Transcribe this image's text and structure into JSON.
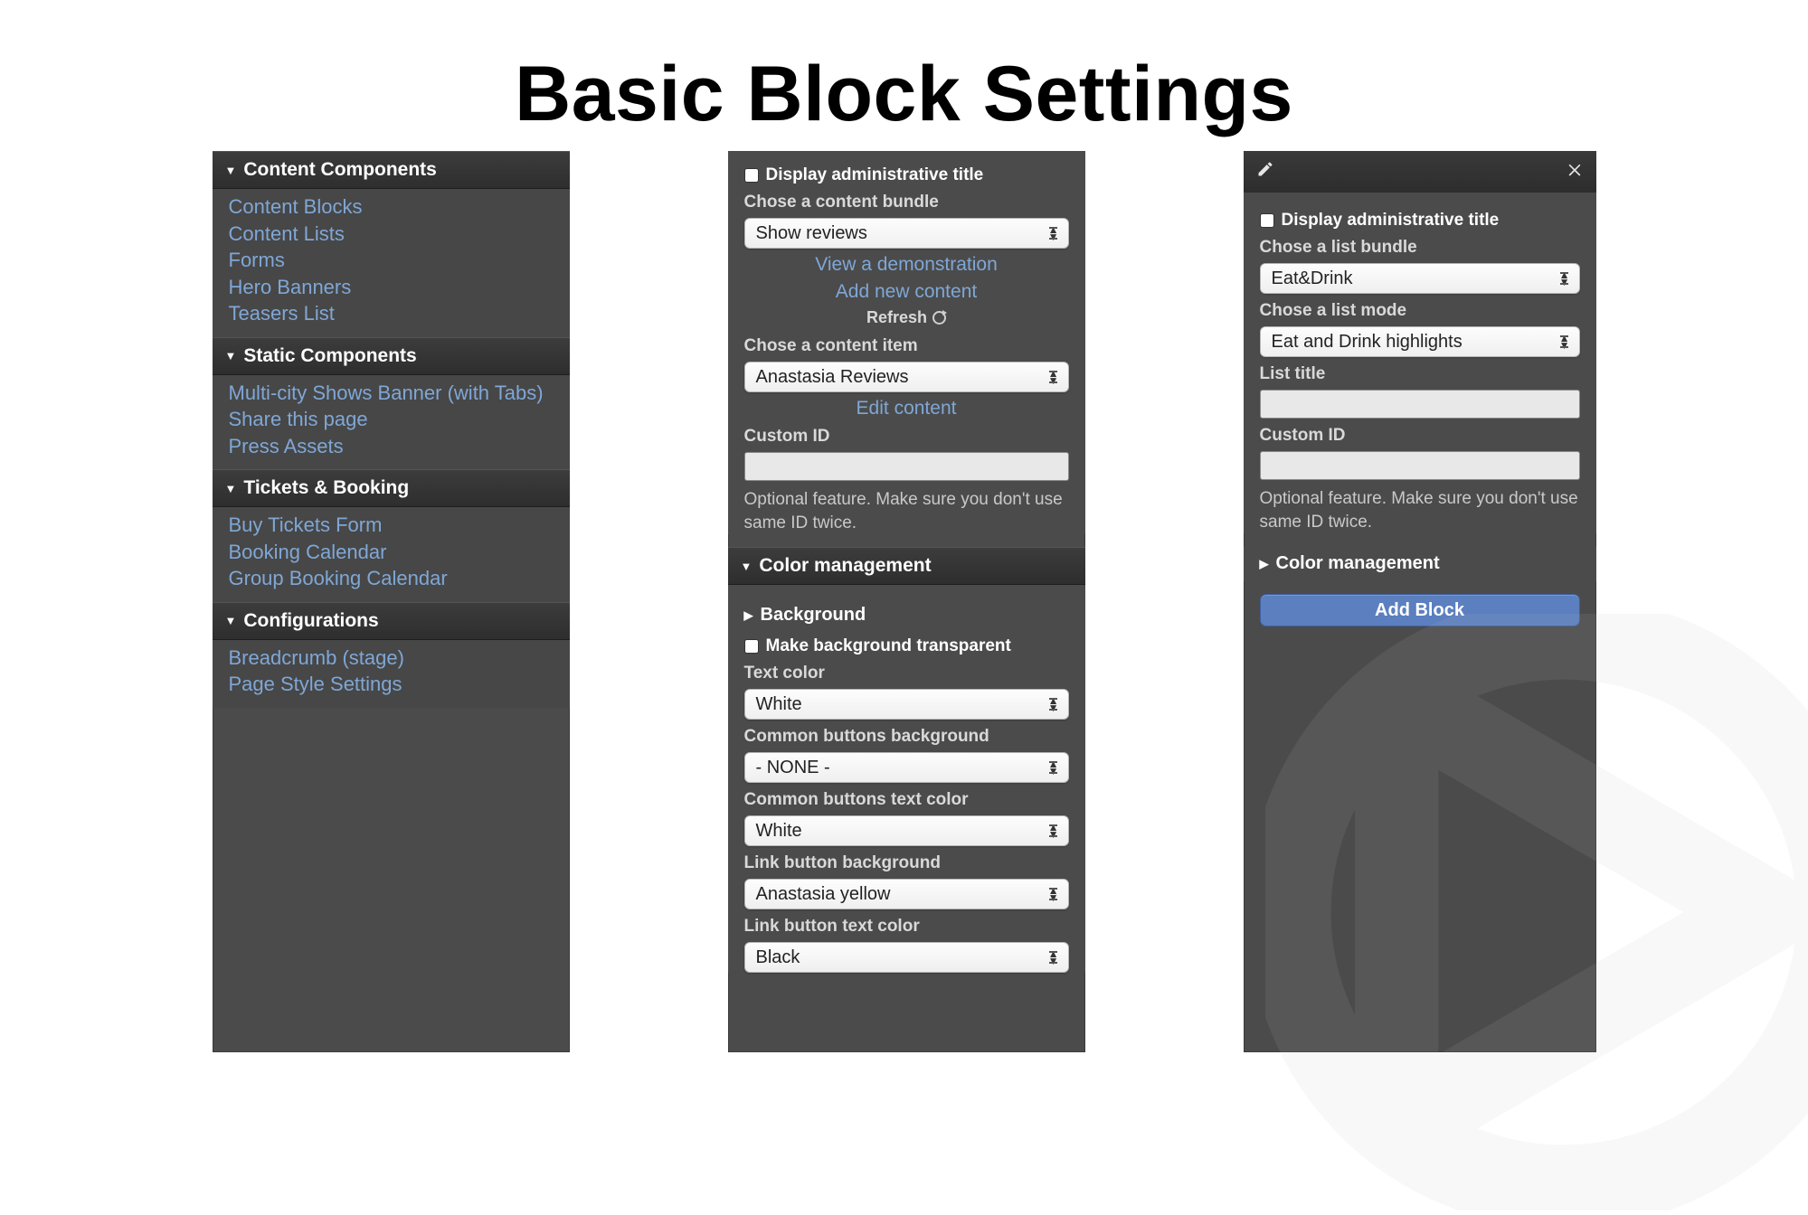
{
  "title": "Basic Block Settings",
  "panel1": {
    "sections": [
      {
        "title": "Content Components",
        "items": [
          "Content Blocks",
          "Content Lists",
          "Forms",
          "Hero Banners",
          "Teasers List"
        ]
      },
      {
        "title": "Static Components",
        "items": [
          "Multi-city Shows Banner (with Tabs)",
          "Share this page",
          "Press Assets"
        ]
      },
      {
        "title": "Tickets & Booking",
        "items": [
          "Buy Tickets Form",
          "Booking Calendar",
          "Group Booking Calendar"
        ]
      },
      {
        "title": "Configurations",
        "items": [
          "Breadcrumb (stage)",
          "Page Style Settings"
        ]
      }
    ]
  },
  "panel2": {
    "display_admin_label": "Display administrative title",
    "bundle_label": "Chose a content bundle",
    "bundle_value": "Show reviews",
    "view_demo": "View a demonstration",
    "add_new": "Add new content",
    "refresh": "Refresh",
    "item_label": "Chose a content item",
    "item_value": "Anastasia Reviews",
    "edit_content": "Edit content",
    "custom_id_label": "Custom ID",
    "custom_id_help": "Optional feature. Make sure you don't use same ID twice.",
    "color_mgmt": "Color management",
    "background": "Background",
    "make_bg_transparent": "Make background transparent",
    "text_color_label": "Text color",
    "text_color_value": "White",
    "btn_bg_label": "Common buttons background",
    "btn_bg_value": "- NONE -",
    "btn_text_label": "Common buttons text color",
    "btn_text_value": "White",
    "link_bg_label": "Link button background",
    "link_bg_value": "Anastasia yellow",
    "link_text_label": "Link button text color",
    "link_text_value": "Black"
  },
  "panel3": {
    "display_admin_label": "Display administrative title",
    "list_bundle_label": "Chose a list bundle",
    "list_bundle_value": "Eat&Drink",
    "list_mode_label": "Chose a list mode",
    "list_mode_value": "Eat and Drink highlights",
    "list_title_label": "List title",
    "custom_id_label": "Custom ID",
    "custom_id_help": "Optional feature. Make sure you don't use same ID twice.",
    "color_mgmt": "Color management",
    "add_block": "Add Block"
  }
}
